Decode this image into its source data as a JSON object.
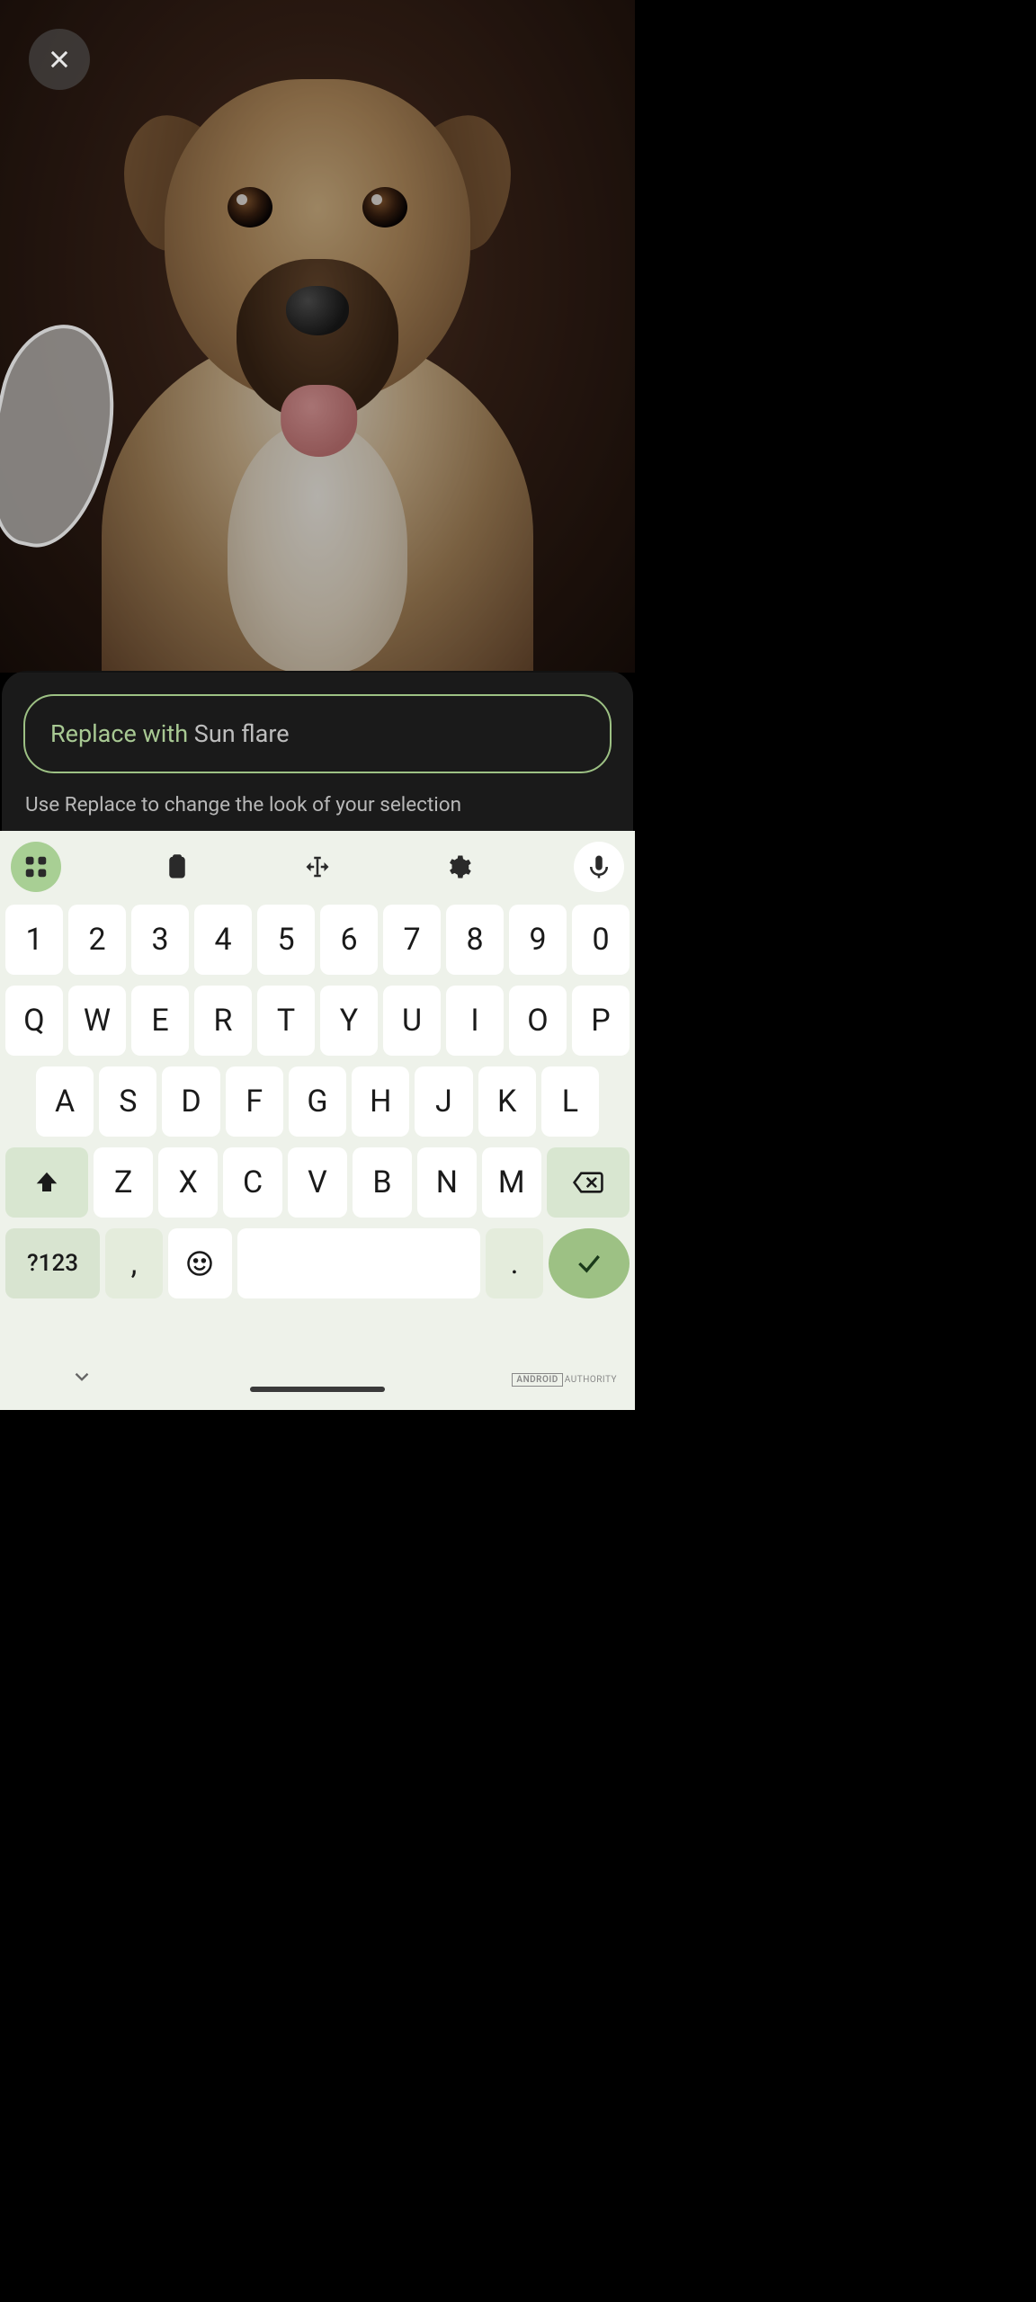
{
  "editor": {
    "input_label": "Replace with",
    "input_value": "Sun flare",
    "hint": "Use Replace to change the look of your selection"
  },
  "keyboard": {
    "row_num": [
      "1",
      "2",
      "3",
      "4",
      "5",
      "6",
      "7",
      "8",
      "9",
      "0"
    ],
    "row1": [
      "Q",
      "W",
      "E",
      "R",
      "T",
      "Y",
      "U",
      "I",
      "O",
      "P"
    ],
    "row2": [
      "A",
      "S",
      "D",
      "F",
      "G",
      "H",
      "J",
      "K",
      "L"
    ],
    "row3": [
      "Z",
      "X",
      "C",
      "V",
      "B",
      "N",
      "M"
    ],
    "symbols_label": "?123",
    "comma": ",",
    "period": "."
  },
  "watermark": {
    "brand": "ANDROID",
    "suffix": "AUTHORITY"
  }
}
